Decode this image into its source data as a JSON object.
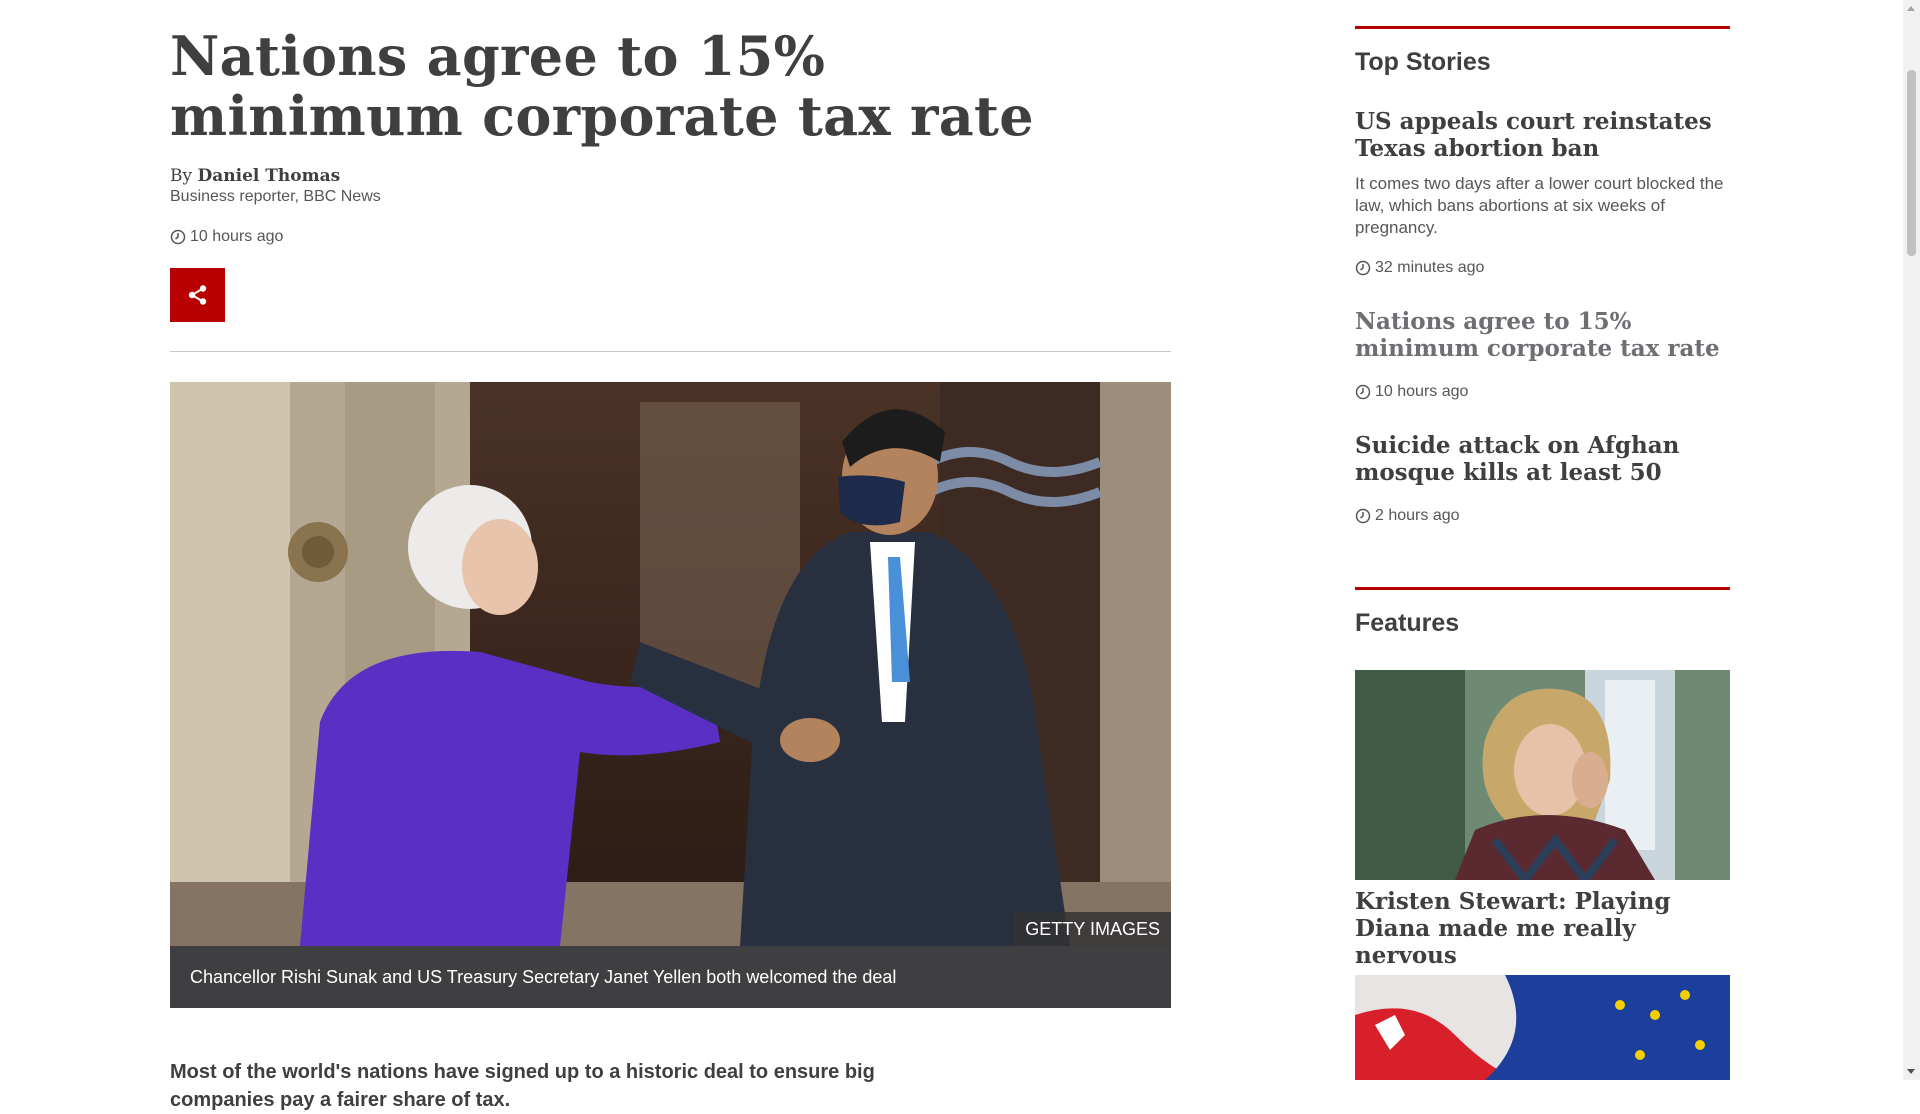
{
  "article": {
    "headline": "Nations agree to 15% minimum corporate tax rate",
    "byline_prefix": "By ",
    "author": "Daniel Thomas",
    "author_role": "Business reporter, BBC News",
    "published": "10 hours ago",
    "image_credit": "GETTY IMAGES",
    "image_caption": "Chancellor Rishi Sunak and US Treasury Secretary Janet Yellen both welcomed the deal",
    "lede": "Most of the world's nations have signed up to a historic deal to ensure big companies pay a fairer share of tax."
  },
  "sidebar": {
    "top_stories_title": "Top Stories",
    "stories": [
      {
        "title": "US appeals court reinstates Texas abortion ban",
        "summary": "It comes two days after a lower court blocked the law, which bans abortions at six weeks of pregnancy.",
        "time": "32 minutes ago"
      },
      {
        "title": "Nations agree to 15% minimum corporate tax rate",
        "time": "10 hours ago"
      },
      {
        "title": "Suicide attack on Afghan mosque kills at least 50",
        "time": "2 hours ago"
      }
    ],
    "features_title": "Features",
    "features": [
      {
        "title": "Kristen Stewart: Playing Diana made me really nervous"
      }
    ]
  },
  "colors": {
    "brand_red": "#b80000",
    "text": "#3f3f42",
    "muted": "#545658"
  }
}
